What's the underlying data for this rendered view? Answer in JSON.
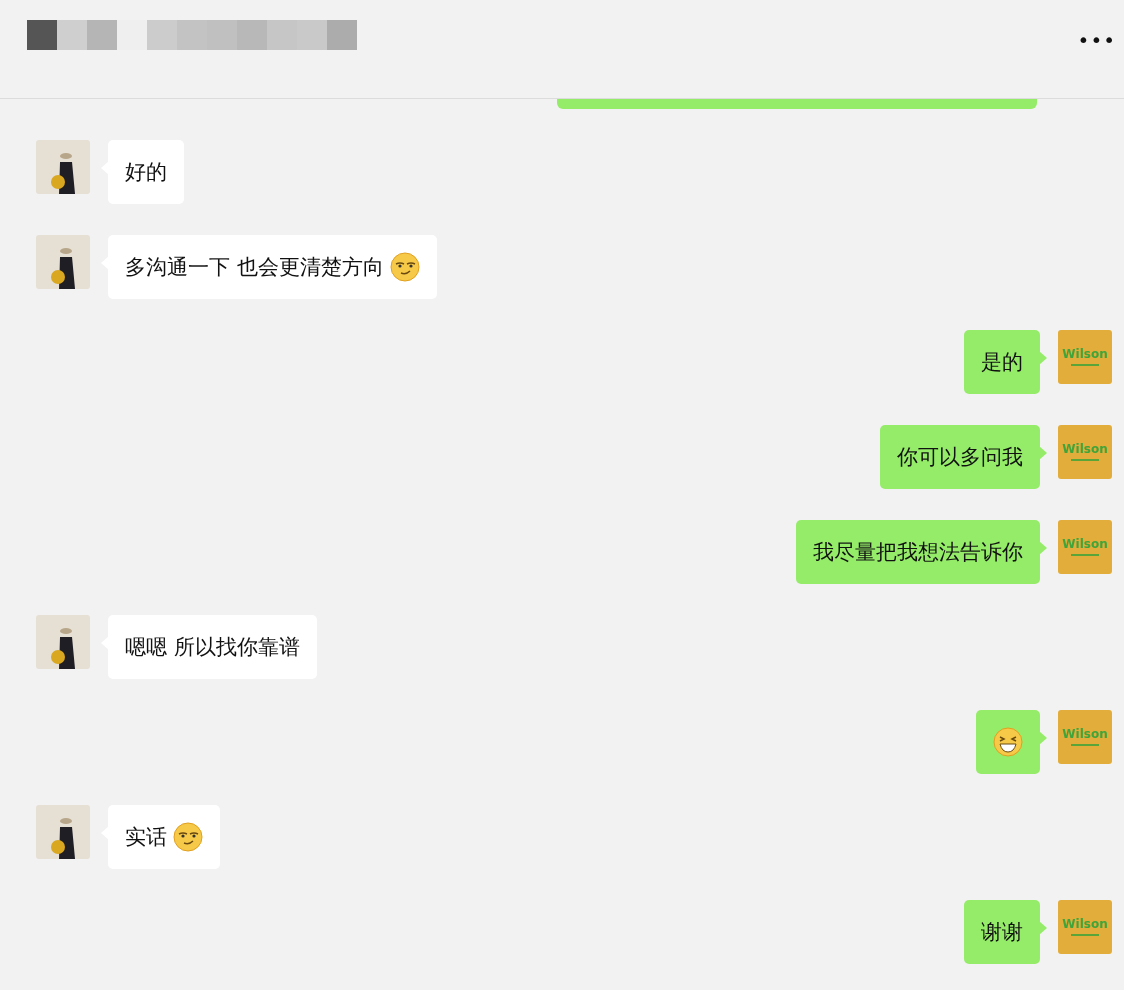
{
  "header": {
    "more": "•••"
  },
  "messages": [
    {
      "outgoing": true,
      "kind": "clipped"
    },
    {
      "outgoing": false,
      "kind": "text",
      "text": "好的"
    },
    {
      "outgoing": false,
      "kind": "text",
      "text": "多沟通一下 也会更清楚方向",
      "emoji": {
        "kind": "smirk"
      }
    },
    {
      "outgoing": true,
      "kind": "text",
      "text": "是的",
      "avatar_label": "Wilson"
    },
    {
      "outgoing": true,
      "kind": "text",
      "text": "你可以多问我",
      "avatar_label": "Wilson"
    },
    {
      "outgoing": true,
      "kind": "text",
      "text": "我尽量把我想法告诉你",
      "avatar_label": "Wilson"
    },
    {
      "outgoing": false,
      "kind": "text",
      "text": "嗯嗯 所以找你靠谱"
    },
    {
      "outgoing": true,
      "kind": "emoji",
      "emoji": {
        "kind": "grin"
      },
      "avatar_label": "Wilson"
    },
    {
      "outgoing": false,
      "kind": "text",
      "text": "实话",
      "emoji": {
        "kind": "smirk"
      }
    },
    {
      "outgoing": true,
      "kind": "text",
      "text": "谢谢",
      "avatar_label": "Wilson"
    }
  ]
}
